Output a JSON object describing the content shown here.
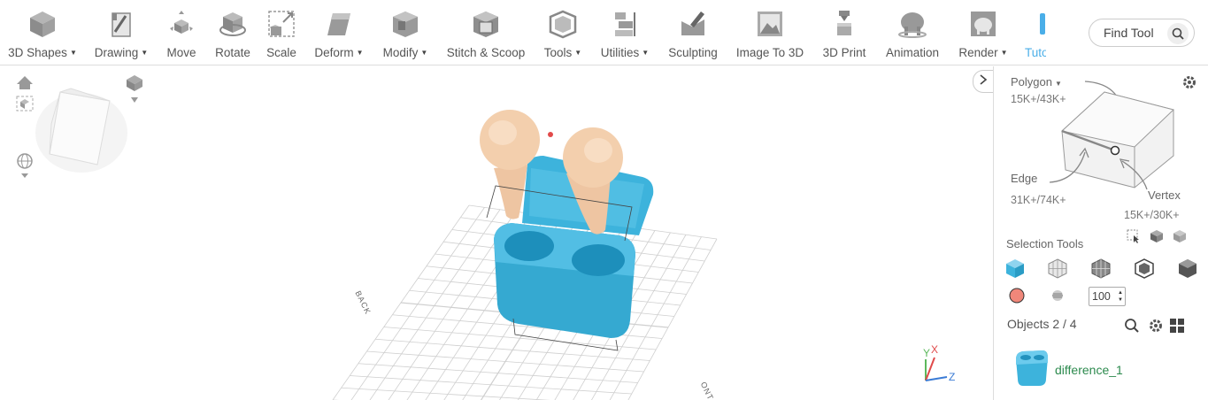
{
  "toolbar": {
    "tools": [
      {
        "label": "3D Shapes",
        "dropdown": true,
        "icon": "cube-icon"
      },
      {
        "label": "Drawing",
        "dropdown": true,
        "icon": "drawing-icon"
      },
      {
        "label": "Move",
        "dropdown": false,
        "icon": "move-icon"
      },
      {
        "label": "Rotate",
        "dropdown": false,
        "icon": "rotate-icon"
      },
      {
        "label": "Scale",
        "dropdown": false,
        "icon": "scale-icon"
      },
      {
        "label": "Deform",
        "dropdown": true,
        "icon": "deform-icon"
      },
      {
        "label": "Modify",
        "dropdown": true,
        "icon": "modify-icon"
      },
      {
        "label": "Stitch & Scoop",
        "dropdown": false,
        "icon": "stitch-scoop-icon"
      },
      {
        "label": "Tools",
        "dropdown": true,
        "icon": "tools-icon"
      },
      {
        "label": "Utilities",
        "dropdown": true,
        "icon": "utilities-icon"
      },
      {
        "label": "Sculpting",
        "dropdown": false,
        "icon": "sculpting-icon"
      },
      {
        "label": "Image To 3D",
        "dropdown": false,
        "icon": "image-to-3d-icon"
      },
      {
        "label": "3D Print",
        "dropdown": false,
        "icon": "3d-print-icon"
      },
      {
        "label": "Animation",
        "dropdown": false,
        "icon": "animation-icon"
      },
      {
        "label": "Render",
        "dropdown": true,
        "icon": "render-icon"
      },
      {
        "label": "Tuto",
        "dropdown": false,
        "icon": "tutorial-icon"
      }
    ],
    "find_tool": {
      "label": "Find Tool",
      "icon": "search-icon"
    }
  },
  "viewport": {
    "grid_labels": {
      "back": "BACK",
      "front": "ONT"
    },
    "axes": {
      "x": "X",
      "y": "Y",
      "z": "Z"
    },
    "colors": {
      "case": "#3db3dc",
      "earbud": "#f3cfad",
      "grid": "#cfcfcf",
      "axis_x": "#e04a4a",
      "axis_y": "#5cb85c",
      "axis_z": "#3a7bd5"
    }
  },
  "panel": {
    "polygon": {
      "label": "Polygon",
      "count": "15K+/43K+"
    },
    "edge": {
      "label": "Edge",
      "count": "31K+/74K+"
    },
    "vertex": {
      "label": "Vertex",
      "count": "15K+/30K+"
    },
    "selection_tools_label": "Selection Tools",
    "selection_value": "100",
    "objects_title": "Objects 2 / 4",
    "objects": [
      {
        "name": "difference_1",
        "color": "#3db3dc"
      }
    ],
    "colors": {
      "swatch": "#f0877a",
      "object_name": "#2c8a4e",
      "accent": "#4aaee8"
    }
  }
}
